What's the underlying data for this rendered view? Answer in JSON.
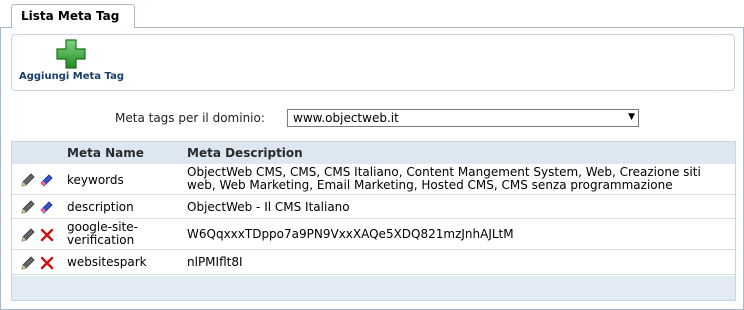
{
  "tab": {
    "label": "Lista Meta Tag"
  },
  "toolbar": {
    "add_label": "Aggiungi Meta Tag"
  },
  "domain": {
    "label": "Meta tags per il dominio:",
    "selected": "www.objectweb.it"
  },
  "table": {
    "columns": [
      "Meta Name",
      "Meta Description"
    ],
    "rows": [
      {
        "name": "keywords",
        "description": "ObjectWeb CMS, CMS, CMS Italiano, Content Mangement System, Web, Creazione siti web, Web Marketing, Email Marketing, Hosted CMS, CMS senza programmazione"
      },
      {
        "name": "description",
        "description": "ObjectWeb - Il CMS Italiano"
      },
      {
        "name": "google-site-verification",
        "description": "W6QqxxxTDppo7a9PN9VxxXAQe5XDQ821mzJnhAJLtM"
      },
      {
        "name": "websitespark",
        "description": "nlPMIflt8I"
      }
    ]
  },
  "colors": {
    "header_bg": "#dce7f2",
    "add_icon": "#3aa83a",
    "delete_icon": "#cc1111",
    "eraser_icon": "#3355cc"
  },
  "icons": {
    "add": "plus-icon",
    "edit": "pencil-icon",
    "erase": "eraser-icon",
    "delete": "delete-x-icon"
  }
}
